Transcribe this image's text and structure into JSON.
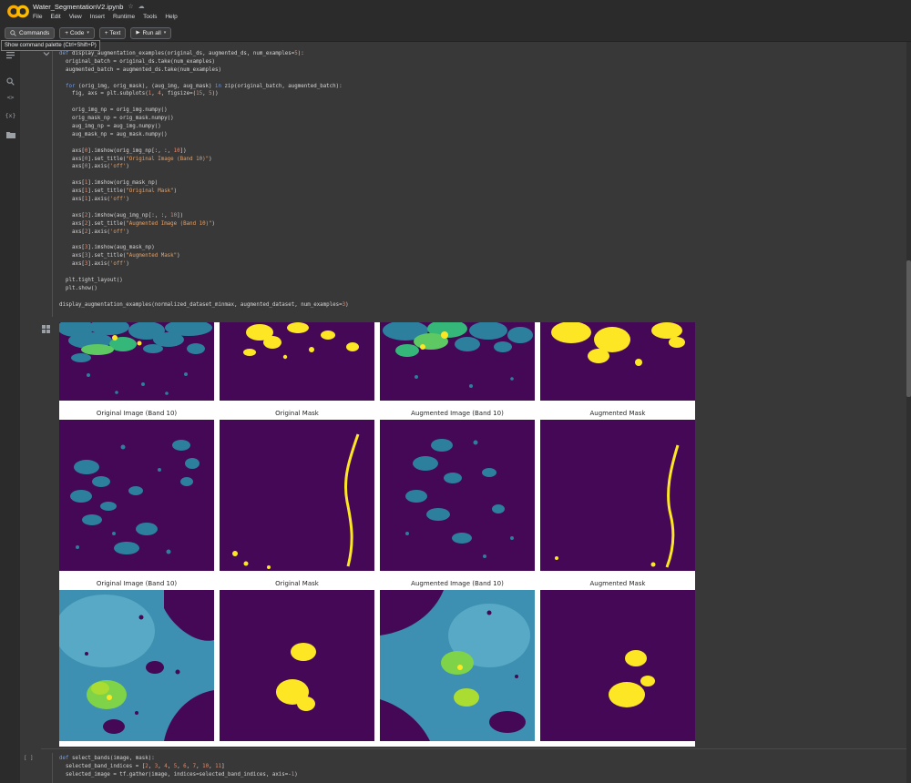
{
  "header": {
    "title": "Water_SegmentationV2.ipynb",
    "menus": [
      "File",
      "Edit",
      "View",
      "Insert",
      "Runtime",
      "Tools",
      "Help"
    ]
  },
  "toolbar": {
    "commands": "Commands",
    "add_code": "+ Code",
    "add_text": "+ Text",
    "run_all": "Run all"
  },
  "tooltip": "Show command palette (Ctrl+Shift+P)",
  "cells": {
    "cell1": {
      "code": [
        "def display_augmentation_examples(original_ds, augmented_ds, num_examples=5):",
        "  original_batch = original_ds.take(num_examples)",
        "  augmented_batch = augmented_ds.take(num_examples)",
        "",
        "  for (orig_img, orig_mask), (aug_img, aug_mask) in zip(original_batch, augmented_batch):",
        "    fig, axs = plt.subplots(1, 4, figsize=(15, 5))",
        "",
        "    orig_img_np = orig_img.numpy()",
        "    orig_mask_np = orig_mask.numpy()",
        "    aug_img_np = aug_img.numpy()",
        "    aug_mask_np = aug_mask.numpy()",
        "",
        "    axs[0].imshow(orig_img_np[:, :, 10])",
        "    axs[0].set_title(\"Original Image (Band 10)\")",
        "    axs[0].axis('off')",
        "",
        "    axs[1].imshow(orig_mask_np)",
        "    axs[1].set_title(\"Original Mask\")",
        "    axs[1].axis('off')",
        "",
        "    axs[2].imshow(aug_img_np[:, :, 10])",
        "    axs[2].set_title(\"Augmented Image (Band 10)\")",
        "    axs[2].axis('off')",
        "",
        "    axs[3].imshow(aug_mask_np)",
        "    axs[3].set_title(\"Augmented Mask\")",
        "    axs[3].axis('off')",
        "",
        "  plt.tight_layout()",
        "  plt.show()",
        "",
        "display_augmentation_examples(normalized_dataset_minmax, augmented_dataset, num_examples=3)"
      ]
    },
    "cell2": {
      "prompt": "[ ]",
      "code": [
        "def select_bands(image, mask):",
        "  selected_band_indices = [2, 3, 4, 5, 6, 7, 10, 11]",
        "  selected_image = tf.gather(image, indices=selected_band_indices, axis=-1)"
      ]
    }
  },
  "output": {
    "column_titles": [
      "Original Image (Band 10)",
      "Original Mask",
      "Augmented Image (Band 10)",
      "Augmented Mask"
    ]
  },
  "colors": {
    "brand_orange": "#F9AB00",
    "viridis_purple": "#440856",
    "viridis_teal": "#2d7f9e",
    "viridis_green": "#35b779",
    "viridis_yellow": "#fde725"
  }
}
